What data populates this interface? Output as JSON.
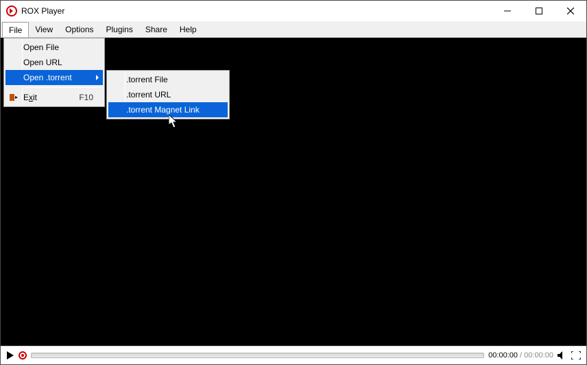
{
  "title": "ROX Player",
  "menubar": {
    "file": "File",
    "view": "View",
    "options": "Options",
    "plugins": "Plugins",
    "share": "Share",
    "help": "Help"
  },
  "fileMenu": {
    "openFile": "Open File",
    "openURL": "Open URL",
    "openTorrent": "Open .torrent",
    "exit_pre": "E",
    "exit_ul": "x",
    "exit_post": "it",
    "exitShortcut": "F10"
  },
  "torrentMenu": {
    "file": ".torrent File",
    "url": ".torrent URL",
    "magnet": ".torrent Magnet Link"
  },
  "playback": {
    "elapsed": "00:00:00",
    "sep": " / ",
    "duration": "00:00:00"
  }
}
